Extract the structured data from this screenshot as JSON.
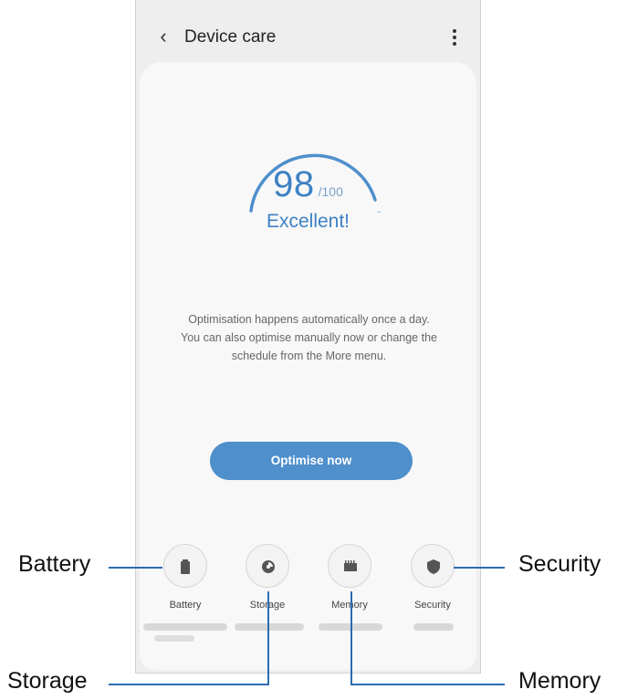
{
  "appbar": {
    "title": "Device care",
    "back_icon": "chevron-left-icon",
    "more_icon": "more-vertical-icon"
  },
  "score": {
    "value": "98",
    "max": "/100",
    "status": "Excellent!",
    "fraction": 0.98
  },
  "description": [
    "Optimisation happens automatically once a day.",
    "You can also optimise manually now or change the",
    "schedule from the More menu."
  ],
  "optimise_button": "Optimise now",
  "tiles": [
    {
      "label": "Battery",
      "icon": "battery-icon"
    },
    {
      "label": "Storage",
      "icon": "storage-pie-icon"
    },
    {
      "label": "Memory",
      "icon": "memory-chip-icon"
    },
    {
      "label": "Security",
      "icon": "shield-icon"
    }
  ],
  "callouts": {
    "battery": "Battery",
    "storage": "Storage",
    "memory": "Memory",
    "security": "Security"
  },
  "colors": {
    "accent": "#3e81c4",
    "button": "#4e8fcc",
    "callout_line": "#2b6cb0"
  }
}
